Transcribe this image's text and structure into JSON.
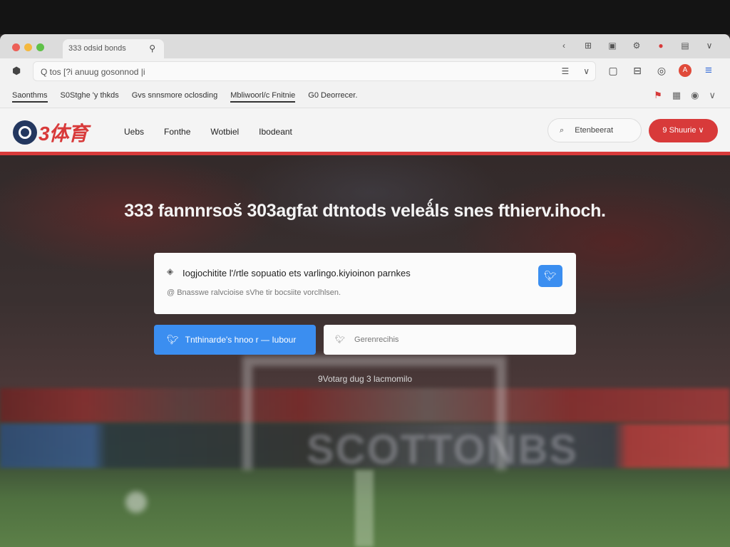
{
  "browser": {
    "tab": {
      "title": "333 odsid bonds",
      "icon": "search-icon"
    },
    "tabbar_icons": [
      "chevron-left-icon",
      "grid-icon",
      "puzzle-icon",
      "extension-icon",
      "notification-icon",
      "sidebar-icon",
      "chevron-down-icon"
    ],
    "url": {
      "prefix": "Q",
      "text": "Q  tos  [?i anuug gosonnod |i",
      "icons": [
        "bookmark-icon",
        "chevron-down-icon"
      ]
    },
    "toolbar_right": [
      "square-icon",
      "share-icon",
      "profile-icon",
      "avatar-icon",
      "menu-icon"
    ],
    "avatar_letter": "A",
    "bookmarks": [
      "Saonthms",
      "S0Stghe 'y thkds",
      "Gvs snnsmore oclosding",
      "Mbliwoorl/c Fnitnie",
      "G0  Deorrecer."
    ],
    "bookmarks_right": [
      "flag-icon",
      "calendar-icon",
      "record-icon",
      "chevron-down-icon"
    ]
  },
  "site": {
    "logo_text": "3体育",
    "nav": [
      "Uebs",
      "Fonthe",
      "Wotbiel",
      "Ibodeant"
    ],
    "search_label": "Etenbeerat",
    "cta_label": "9 Shuurie"
  },
  "hero": {
    "title": "333 fannnrsoš 303agfat dtntods veleǻls snes fthierv.ihoch.",
    "card": {
      "title": "Iogjochitite l'/rtle sopuatio ets varlingo.kiyioinon parnkes",
      "subtitle": "@ Bnasswe ralvcioise sVhe tir bocsiite vorclhlsen."
    },
    "primary_button": "Tnthinarde's hnoo r — Iubour",
    "secondary_button": "Gerenrecihis",
    "note": "9Votarg dug 3 lacmomilo"
  },
  "colors": {
    "brand_red": "#d83a3a",
    "accent_blue": "#3b8ef0",
    "logo_navy": "#23375f"
  }
}
